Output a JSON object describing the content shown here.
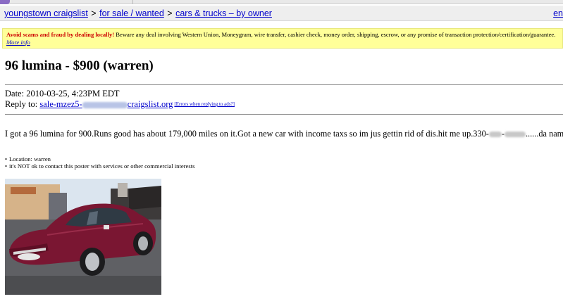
{
  "breadcrumb": {
    "items": [
      "youngstown craigslist",
      "for sale / wanted",
      "cars & trucks – by owner"
    ],
    "separator": ">",
    "right_link": "en"
  },
  "warning": {
    "strong": "Avoid scams and fraud by dealing locally!",
    "text": " Beware any deal involving Western Union, Moneygram, wire transfer, cashier check, money order, shipping, escrow, or any promise of transaction protection/certification/guarantee. ",
    "link": "More info"
  },
  "posting": {
    "title": "96 lumina - $900 (warren)",
    "date_label": "Date: ",
    "date": "2010-03-25, 4:23PM EDT",
    "reply_label": "Reply to: ",
    "reply_prefix": "sale-mzez5-",
    "reply_suffix": "craigslist.org",
    "errors_link": "[Errors when replying to ads?]",
    "body_start": "I got a 96 lumina for 900.Runs good has about 179,000 miles on it.Got a new car with income taxs so im jus gettin rid of dis.hit me up.330-",
    "body_end": "......da names ace.",
    "details": [
      "Location: warren",
      "it's NOT ok to contact this poster with services or other commercial interests"
    ]
  },
  "photo": {
    "car_color": "#7a1632"
  },
  "colors": {
    "link": "#0000cc",
    "warning_bg": "#ffff99",
    "warning_strong": "#cc0000"
  }
}
